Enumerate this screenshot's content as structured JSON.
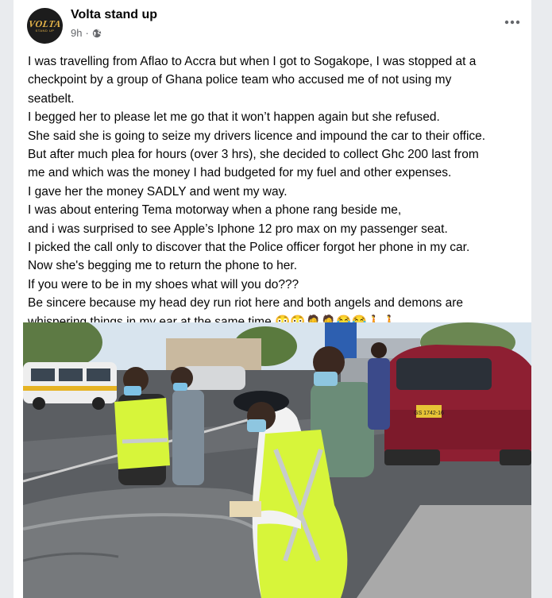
{
  "post": {
    "author": {
      "name": "Volta stand up",
      "avatar_logo": "VOLTA",
      "avatar_sub": "STAND UP"
    },
    "time": "9h",
    "separator": "·",
    "privacy_icon": "globe-icon",
    "more_icon": "more-horizontal-icon",
    "text_lines": [
      "I was travelling from Aflao to Accra but when I got to Sogakope, I was stopped at a",
      "checkpoint by a group of Ghana police team who accused me of not using my",
      "seatbelt.",
      "I begged her to please let me go that it won’t happen again but she refused.",
      "She said she is going to seize my drivers licence and impound the car to their office.",
      "But after much plea for hours (over 3 hrs), she decided to collect Ghc 200 last from",
      "me and which was the money I had budgeted for my fuel and other expenses.",
      "I gave her the money SADLY and went my way.",
      "I was about entering Tema motorway when a phone rang beside me,",
      "and i was surprised to see Apple’s Iphone 12 pro max on my passenger seat.",
      "I picked the call only to discover that the Police officer forgot her phone in my car.",
      "Now she's begging me to return the phone to her.",
      "If you were to be in my shoes what will you do???",
      "Be sincere because my head dey run riot here and both angels and demons are",
      "whispering things in my ear at the same time.😳😳🤦🤦😂😂🚶🚶."
    ],
    "photo": {
      "plate_text": "GS 1742-16"
    }
  },
  "colors": {
    "page_bg": "#e9ebee",
    "card_bg": "#ffffff",
    "text_primary": "#050505",
    "text_secondary": "#65676b",
    "avatar_gold": "#e8b64a",
    "vest_yellow": "#d7f53a",
    "car_red": "#8e1f32"
  }
}
